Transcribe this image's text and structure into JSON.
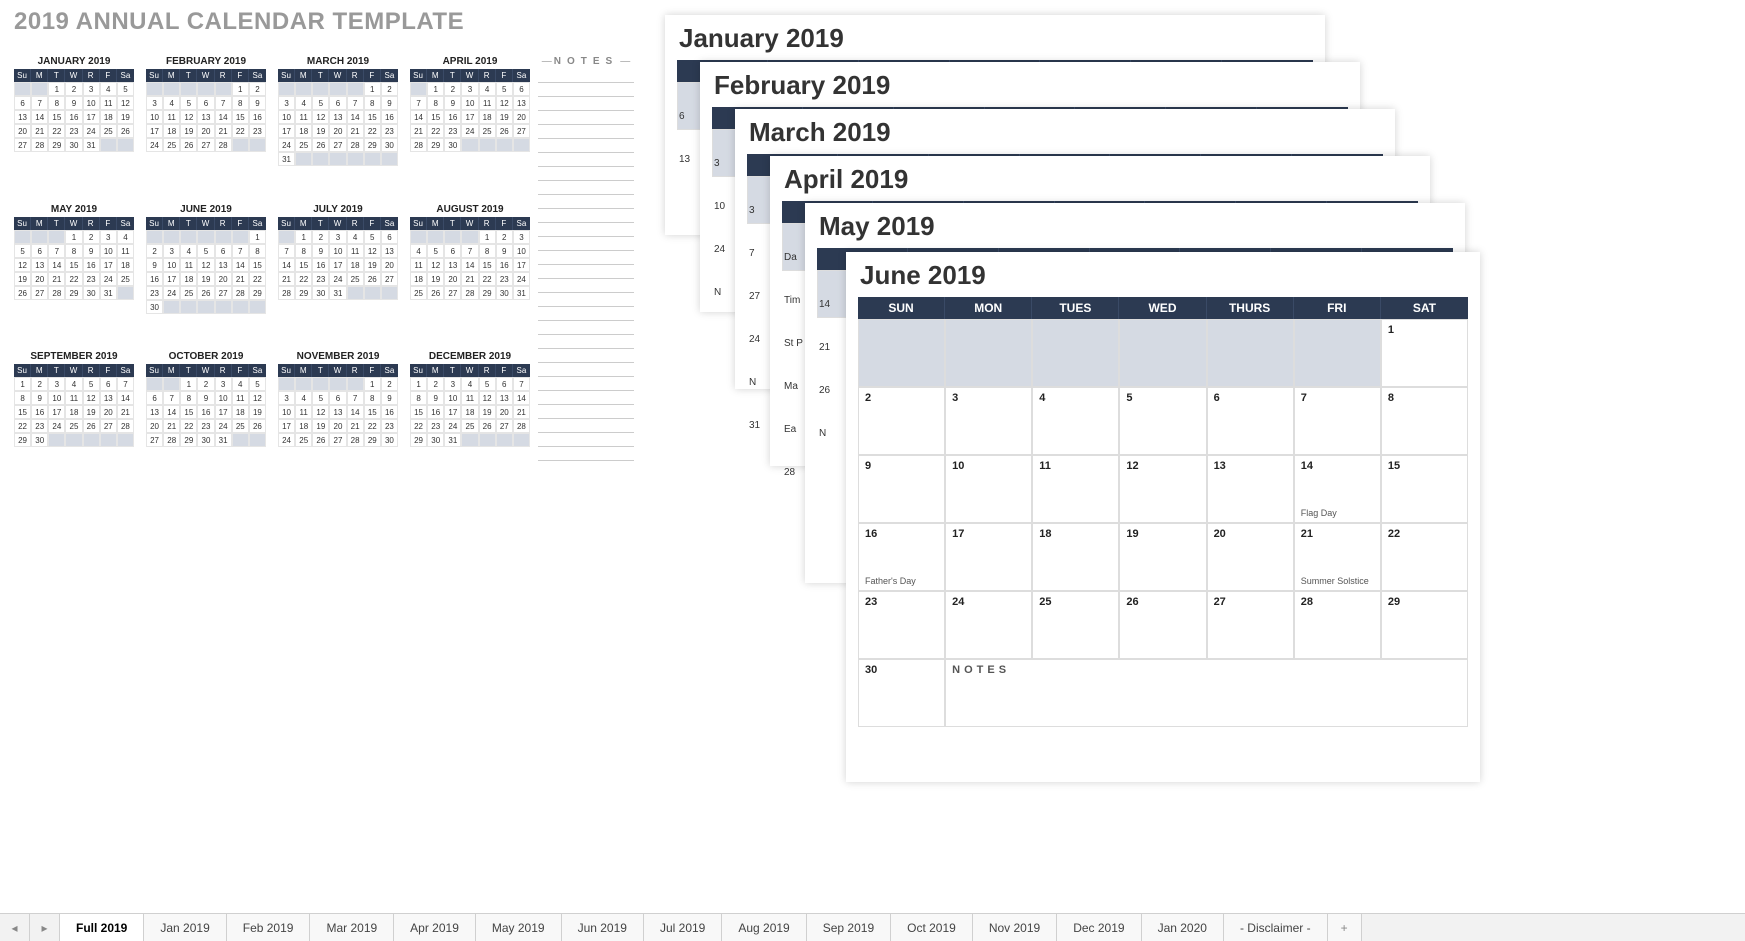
{
  "title": "2019 ANNUAL CALENDAR TEMPLATE",
  "notes_title": "NOTES",
  "day_short": [
    "Su",
    "M",
    "T",
    "W",
    "R",
    "F",
    "Sa"
  ],
  "day_med": [
    "SUN",
    "MON",
    "TUES",
    "WED",
    "THURS",
    "FRI",
    "SAT"
  ],
  "months": {
    "jan": {
      "title": "JANUARY 2019",
      "big": "January 2019",
      "start": 2,
      "days": 31
    },
    "feb": {
      "title": "FEBRUARY 2019",
      "big": "February 2019",
      "start": 5,
      "days": 28
    },
    "mar": {
      "title": "MARCH 2019",
      "big": "March 2019",
      "start": 5,
      "days": 31
    },
    "apr": {
      "title": "APRIL 2019",
      "big": "April 2019",
      "start": 1,
      "days": 30
    },
    "may": {
      "title": "MAY 2019",
      "big": "May 2019",
      "start": 3,
      "days": 31
    },
    "jun": {
      "title": "JUNE 2019",
      "big": "June 2019",
      "start": 6,
      "days": 30
    },
    "jul": {
      "title": "JULY 2019",
      "big": "July 2019",
      "start": 1,
      "days": 31
    },
    "aug": {
      "title": "AUGUST 2019",
      "big": "August 2019",
      "start": 4,
      "days": 31
    },
    "sep": {
      "title": "SEPTEMBER 2019",
      "big": "September 2019",
      "start": 0,
      "days": 30
    },
    "oct": {
      "title": "OCTOBER 2019",
      "big": "October 2019",
      "start": 2,
      "days": 31
    },
    "nov": {
      "title": "NOVEMBER 2019",
      "big": "November 2019",
      "start": 5,
      "days": 30
    },
    "dec": {
      "title": "DECEMBER 2019",
      "big": "December 2019",
      "start": 0,
      "days": 31
    }
  },
  "annual_order": [
    "jan",
    "feb",
    "mar",
    "apr",
    "may",
    "jun",
    "jul",
    "aug",
    "sep",
    "oct",
    "nov",
    "dec"
  ],
  "june_events": {
    "14": "Flag Day",
    "16": "Father's Day",
    "21": "Summer Solstice"
  },
  "stack_keys": [
    "jan",
    "feb",
    "mar",
    "apr",
    "may",
    "jun"
  ],
  "peek_left_text": {
    "jan": [
      "6",
      "13"
    ],
    "feb": [
      "3",
      "10",
      "24",
      "N"
    ],
    "mar": [
      "3",
      "7",
      "27",
      "24",
      "N",
      "31"
    ],
    "apr": [
      "Da",
      "Tim",
      "St P",
      "Ma",
      "Ea",
      "28"
    ],
    "may": [
      "14",
      "21",
      "26",
      "N"
    ]
  },
  "notes_label_row": "NOTES",
  "tabs": [
    "Full 2019",
    "Jan 2019",
    "Feb 2019",
    "Mar 2019",
    "Apr 2019",
    "May 2019",
    "Jun 2019",
    "Jul 2019",
    "Aug 2019",
    "Sep 2019",
    "Oct 2019",
    "Nov 2019",
    "Dec 2019",
    "Jan 2020",
    "- Disclaimer -"
  ],
  "active_tab": 0,
  "nav_prev": "◂",
  "nav_next": "▸",
  "add_tab": "+"
}
